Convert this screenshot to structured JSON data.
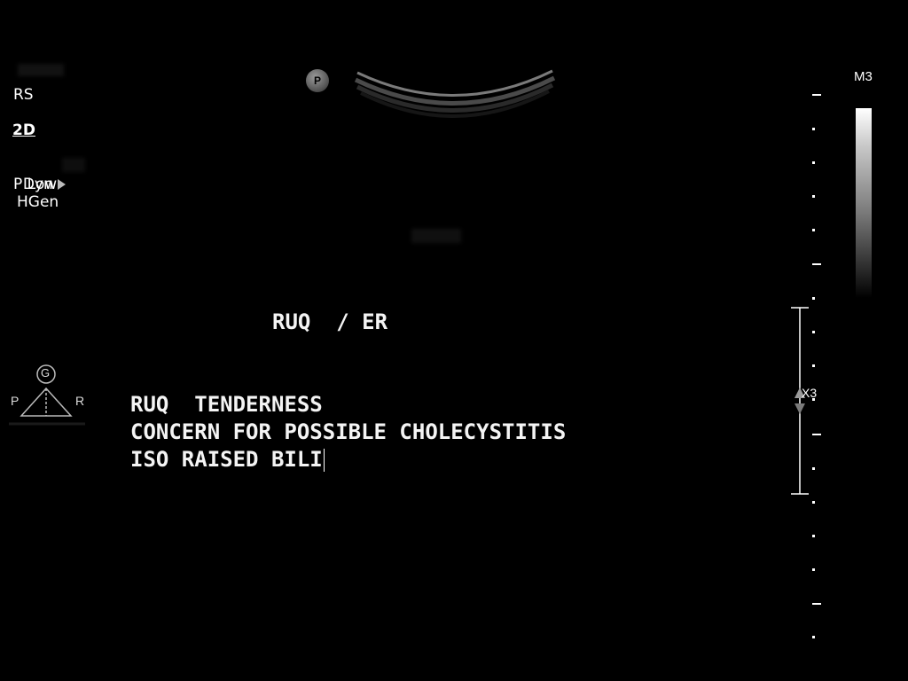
{
  "left_panel": {
    "rs": "RS",
    "mode": "2D",
    "dyn": "Dyn",
    "power": "P Low",
    "freq": "HGen"
  },
  "probe_marker": "P",
  "header_annotation": "RUQ  / ER",
  "annotation_lines": [
    "RUQ  TENDERNESS",
    "CONCERN FOR POSSIBLE CHOLECYSTITIS",
    "ISO RAISED BILI"
  ],
  "grayscale_map": {
    "label": "M3"
  },
  "focus": {
    "label": "X3"
  },
  "orientation": {
    "top": "G",
    "left": "P",
    "right": "R"
  },
  "colors": {
    "background": "#000000",
    "text": "#ffffff"
  }
}
